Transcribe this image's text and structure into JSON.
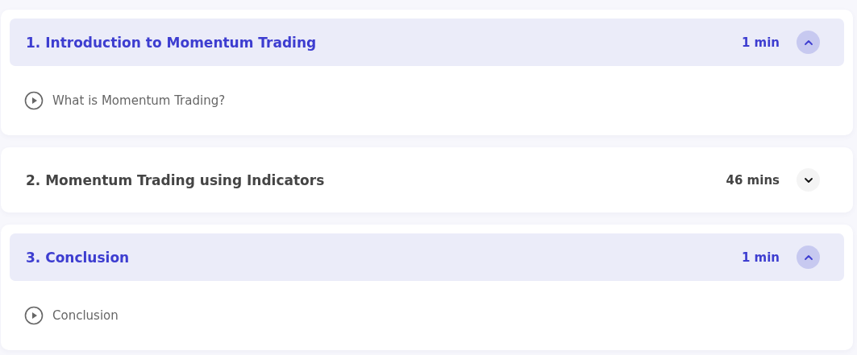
{
  "sections": [
    {
      "title": "1. Introduction to Momentum Trading",
      "duration": "1 min",
      "expanded": true,
      "lessons": [
        {
          "title": "What is Momentum Trading?"
        }
      ]
    },
    {
      "title": "2. Momentum Trading using Indicators",
      "duration": "46 mins",
      "expanded": false
    },
    {
      "title": "3. Conclusion",
      "duration": "1 min",
      "expanded": true,
      "lessons": [
        {
          "title": "Conclusion"
        }
      ]
    }
  ]
}
